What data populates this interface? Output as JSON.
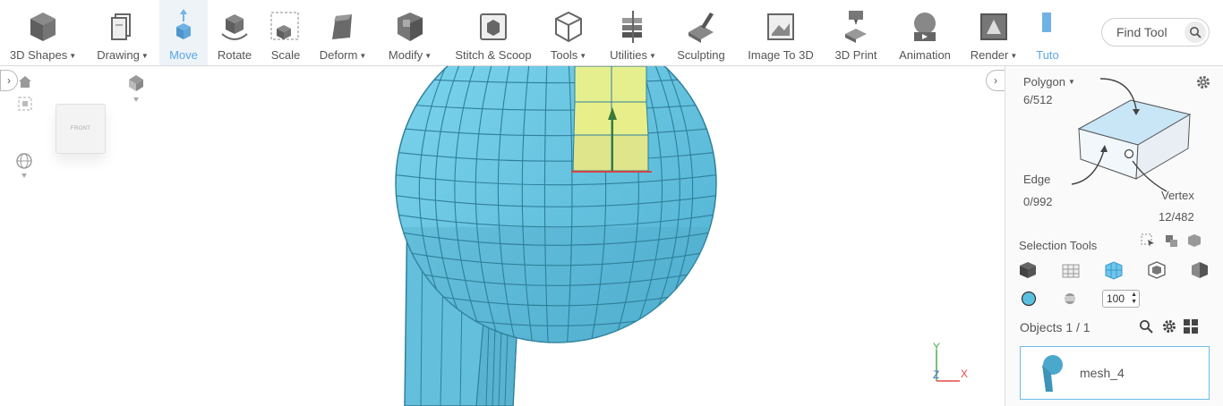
{
  "toolbar": {
    "tools": [
      {
        "label": "3D Shapes",
        "dropdown": true,
        "icon": "cube-icon"
      },
      {
        "label": "Drawing",
        "dropdown": true,
        "icon": "drawing-icon"
      },
      {
        "label": "Move",
        "dropdown": false,
        "icon": "move-icon",
        "active": true
      },
      {
        "label": "Rotate",
        "dropdown": false,
        "icon": "rotate-icon"
      },
      {
        "label": "Scale",
        "dropdown": false,
        "icon": "scale-icon"
      },
      {
        "label": "Deform",
        "dropdown": true,
        "icon": "deform-icon"
      },
      {
        "label": "Modify",
        "dropdown": true,
        "icon": "modify-icon"
      },
      {
        "label": "Stitch & Scoop",
        "dropdown": false,
        "icon": "stitch-scoop-icon"
      },
      {
        "label": "Tools",
        "dropdown": true,
        "icon": "tools-icon"
      },
      {
        "label": "Utilities",
        "dropdown": true,
        "icon": "utilities-icon"
      },
      {
        "label": "Sculpting",
        "dropdown": false,
        "icon": "sculpting-icon"
      },
      {
        "label": "Image To 3D",
        "dropdown": false,
        "icon": "image-to-3d-icon"
      },
      {
        "label": "3D Print",
        "dropdown": false,
        "icon": "3d-print-icon"
      },
      {
        "label": "Animation",
        "dropdown": false,
        "icon": "animation-icon"
      },
      {
        "label": "Render",
        "dropdown": true,
        "icon": "render-icon"
      },
      {
        "label": "Tuto",
        "dropdown": false,
        "icon": "tutorial-icon"
      }
    ],
    "find_tool_label": "Find Tool"
  },
  "viewport": {
    "navcube_face": "FRONT",
    "axis": {
      "x": "X",
      "y": "Y",
      "z": "Z"
    }
  },
  "panel": {
    "selection_mode": "Polygon",
    "polygon_count": "6/512",
    "edge_label": "Edge",
    "edge_count": "0/992",
    "vertex_label": "Vertex",
    "vertex_count": "12/482",
    "selection_tools_label": "Selection Tools",
    "brush_size": "100",
    "objects_label": "Objects 1 / 1",
    "object_name": "mesh_4"
  },
  "colors": {
    "mesh": "#5bc0df",
    "mesh_line": "#2e7f9a",
    "selected_face": "#e6ef8e",
    "active_tool": "#5aa7e6"
  }
}
